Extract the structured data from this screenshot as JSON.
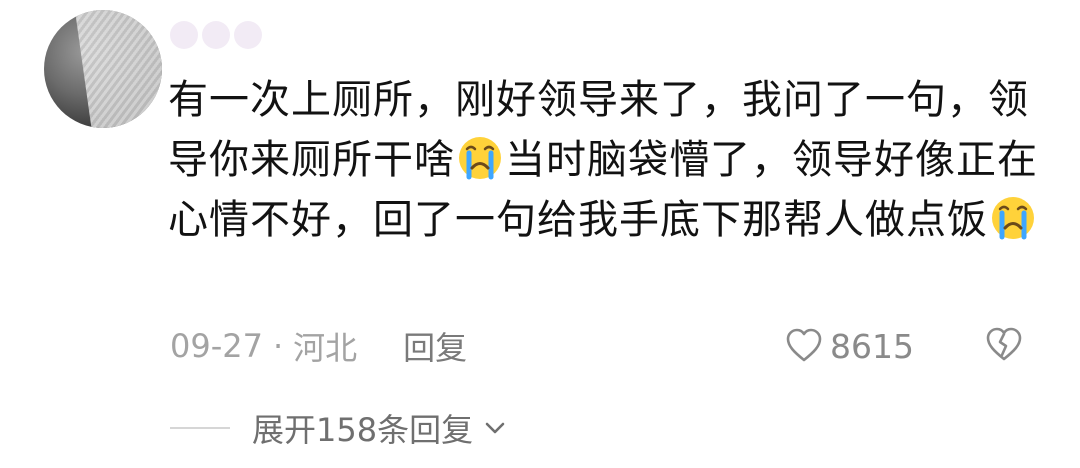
{
  "comment": {
    "text_parts": [
      "有一次上厕所，刚好领导来了，我问了一句，领导你来厕所干啥",
      "当时脑袋懵了，领导好像正在心情不好，回了一句给我手底下那帮人做点饭"
    ],
    "emoji": "crying-face"
  },
  "meta": {
    "date": "09-27",
    "separator": "·",
    "location": "河北",
    "reply_label": "回复"
  },
  "likes": {
    "count": "8615"
  },
  "expand": {
    "label": "展开158条回复"
  },
  "colors": {
    "text": "#121212",
    "meta": "#a3a3a3",
    "icon": "#8a8a8a"
  }
}
